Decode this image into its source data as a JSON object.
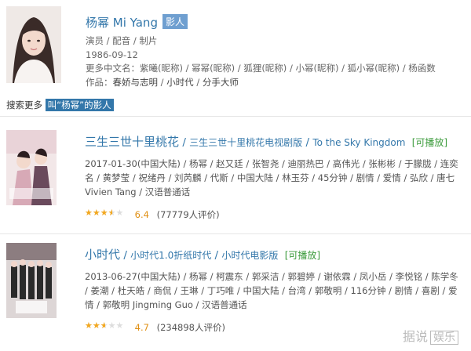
{
  "person": {
    "name": "杨幂 Mi Yang",
    "tag": "影人",
    "roles": "演员 / 配音 / 制片",
    "birthdate": "1986-09-12",
    "other_names_label": "更多中文名：",
    "other_names": "紫曦(昵称) / 幂幂(昵称) / 狐狸(昵称) / 小幂(昵称) / 狐小幂(昵称) / 杨函数",
    "works_label": "作品：",
    "works": [
      "春娇与志明",
      "小时代",
      "分手大师"
    ]
  },
  "search_more": {
    "prefix": "搜索更多",
    "link": "叫“杨幂”的影人"
  },
  "results": [
    {
      "title_main": "三生三世十里桃花",
      "title_alt": "三生三世十里桃花电视剧版",
      "title_en": "To the Sky Kingdom",
      "playable": "[可播放]",
      "meta": "2017-01-30(中国大陆) / 杨幂 / 赵又廷 / 张智尧 / 迪丽热巴 / 高伟光 / 张彬彬 / 于朦胧 / 连奕名 / 黄梦莹 / 祝绪丹 / 刘芮麟 / 代斯 / 中国大陆 / 林玉芬 / 45分钟 / 剧情 / 爱情 / 弘欣 / 唐七 Vivien Tang / 汉语普通话",
      "rating": 6.4,
      "stars_fraction": 0.64,
      "votes": "(77779人评价)"
    },
    {
      "title_main": "小时代",
      "title_alt": "小时代1.0折纸时代",
      "title_en": "小时代电影版",
      "playable": "[可播放]",
      "meta": "2013-06-27(中国大陆) / 杨幂 / 柯震东 / 郭采洁 / 郭碧婷 / 谢依霖 / 凤小岳 / 李悦铭 / 陈学冬 / 姜潮 / 杜天皓 / 商侃 / 王琳 / 丁巧唯 / 中国大陆 / 台湾 / 郭敬明 / 116分钟 / 剧情 / 喜剧 / 爱情 / 郭敬明 Jingming Guo / 汉语普通话",
      "rating": 4.7,
      "stars_fraction": 0.47,
      "votes": "(234898人评价)"
    }
  ],
  "watermark": {
    "text": "据说",
    "box": "娱乐"
  }
}
